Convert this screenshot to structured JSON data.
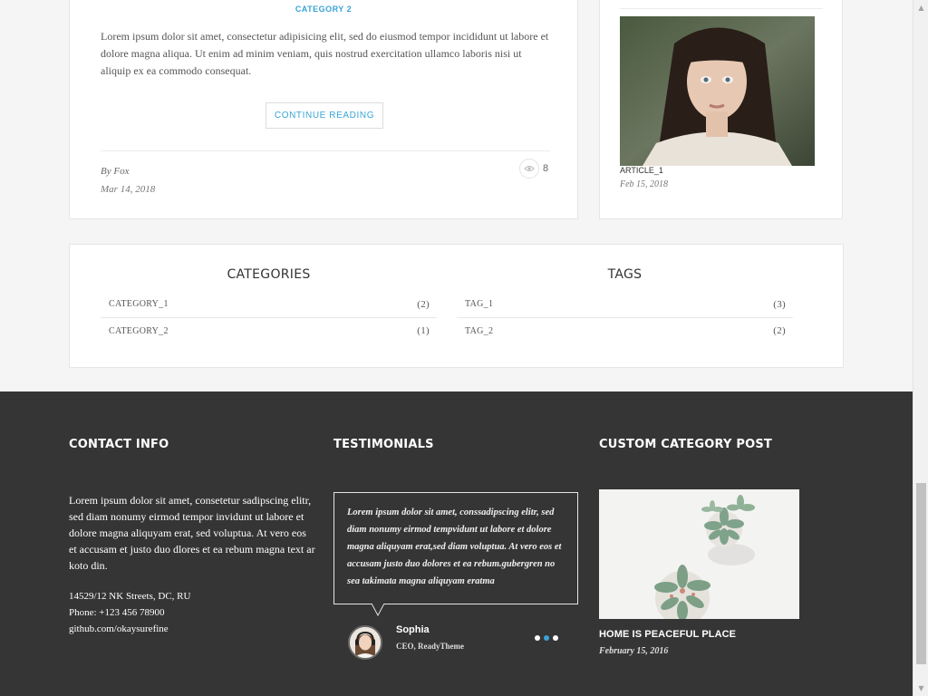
{
  "article": {
    "category": "CATEGORY 2",
    "excerpt": "Lorem ipsum dolor sit amet, consectetur adipisicing elit, sed do eiusmod tempor incididunt ut labore et dolore magna aliqua. Ut enim ad minim veniam, quis nostrud exercitation ullamco laboris nisi ut aliquip ex ea commodo consequat.",
    "continue_label": "CONTINUE READING",
    "author": "By Fox",
    "date": "Mar 14, 2018",
    "views": "8",
    "views_icon": "eye-icon"
  },
  "sidebar_post": {
    "title": "ARTICLE_1",
    "date": "Feb 15, 2018"
  },
  "categories": {
    "heading": "CATEGORIES",
    "items": [
      {
        "name": "CATEGORY_1",
        "count": "(2)"
      },
      {
        "name": "CATEGORY_2",
        "count": "(1)"
      }
    ]
  },
  "tags": {
    "heading": "TAGS",
    "items": [
      {
        "name": "TAG_1",
        "count": "(3)"
      },
      {
        "name": "TAG_2",
        "count": "(2)"
      }
    ]
  },
  "footer": {
    "contact": {
      "heading": "CONTACT INFO",
      "text": "Lorem ipsum dolor sit amet, consetetur sadipscing elitr, sed diam nonumy eirmod tempor invidunt ut labore et dolore magna aliquyam erat, sed voluptua. At vero eos et accusam et justo duo dlores et ea rebum magna text ar koto din.",
      "address": "14529/12 NK Streets, DC, RU",
      "phone": "Phone: +123 456 78900",
      "github": "github.com/okaysurefine"
    },
    "testimonials": {
      "heading": "TESTIMONIALS",
      "quote": "Lorem ipsum dolor sit amet, conssadipscing elitr, sed diam nonumy eirmod tempvidunt ut labore et dolore magna aliquyam erat,sed diam voluptua. At vero eos et accusam justo duo dolores et ea rebum.gubergren no sea takimata magna aliquyam eratma",
      "name": "Sophia",
      "role": "CEO, ReadyTheme",
      "dots": 3,
      "active_dot": 1
    },
    "custom_post": {
      "heading": "CUSTOM CATEGORY POST",
      "title": "HOME IS PEACEFUL PLACE",
      "date": "February 15, 2016"
    }
  },
  "colors": {
    "accent": "#3aa3d6",
    "footer_bg": "#353535",
    "page_bg": "#f5f5f5"
  }
}
